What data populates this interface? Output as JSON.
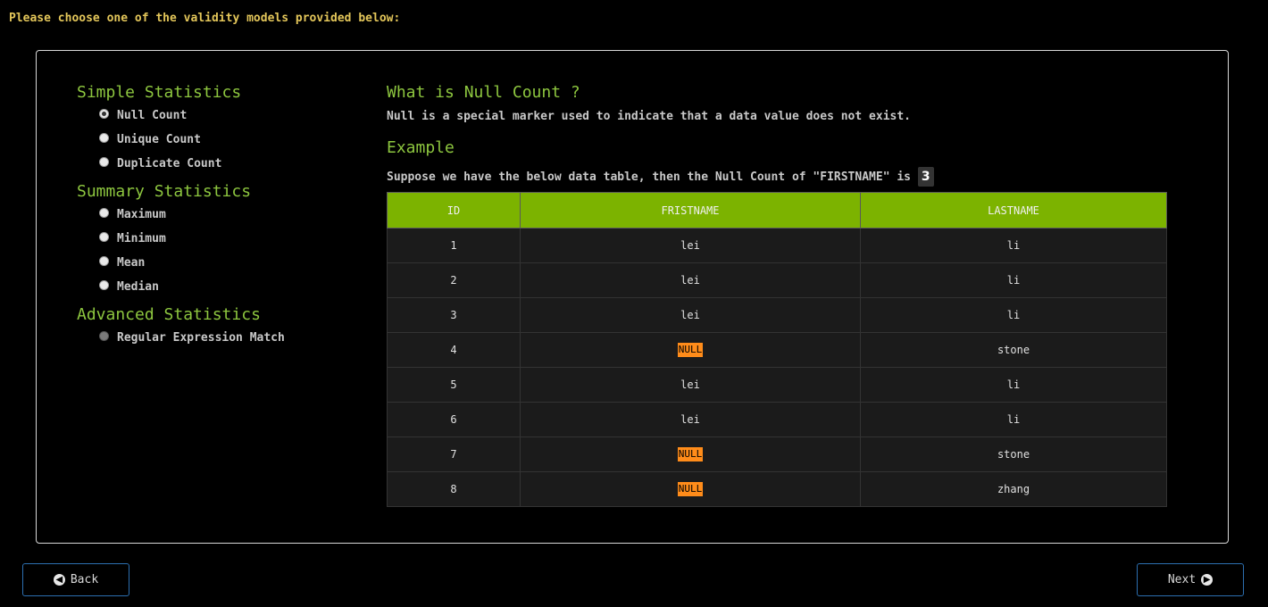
{
  "header": {
    "title": "Please choose one of the validity models provided below:"
  },
  "groups": [
    {
      "title": "Simple Statistics",
      "options": [
        {
          "label": "Null Count",
          "checked": true,
          "disabled": false
        },
        {
          "label": "Unique Count",
          "checked": false,
          "disabled": false
        },
        {
          "label": "Duplicate Count",
          "checked": false,
          "disabled": false
        }
      ]
    },
    {
      "title": "Summary Statistics",
      "options": [
        {
          "label": "Maximum",
          "checked": false,
          "disabled": false
        },
        {
          "label": "Minimum",
          "checked": false,
          "disabled": false
        },
        {
          "label": "Mean",
          "checked": false,
          "disabled": false
        },
        {
          "label": "Median",
          "checked": false,
          "disabled": false
        }
      ]
    },
    {
      "title": "Advanced Statistics",
      "options": [
        {
          "label": "Regular Expression Match",
          "checked": false,
          "disabled": true
        }
      ]
    }
  ],
  "detail": {
    "title": "What is Null Count ?",
    "description": "Null is a special marker used to indicate that a data value does not exist.",
    "example_title": "Example",
    "example_text": "Suppose we have the below data table, then the Null Count of \"FIRSTNAME\" is",
    "example_count": "3"
  },
  "table": {
    "columns": [
      "ID",
      "FRISTNAME",
      "LASTNAME"
    ],
    "rows": [
      [
        "1",
        "lei",
        "li"
      ],
      [
        "2",
        "lei",
        "li"
      ],
      [
        "3",
        "lei",
        "li"
      ],
      [
        "4",
        "NULL",
        "stone"
      ],
      [
        "5",
        "lei",
        "li"
      ],
      [
        "6",
        "lei",
        "li"
      ],
      [
        "7",
        "NULL",
        "stone"
      ],
      [
        "8",
        "NULL",
        "zhang"
      ]
    ]
  },
  "footer": {
    "back_label": "Back",
    "next_label": "Next"
  },
  "colors": {
    "accent": "#8dc63f",
    "header_row": "#7cb300",
    "null_badge": "#ff8c1a",
    "title": "#e3c65a",
    "button_border": "#2c6fb0"
  },
  "icons": {
    "back": "arrow-left-circle-icon",
    "next": "arrow-right-circle-icon"
  }
}
